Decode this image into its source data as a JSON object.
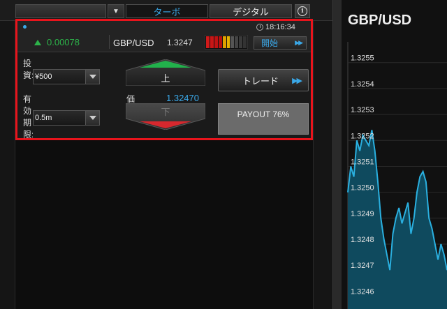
{
  "tabs": {
    "left_label": "",
    "turbo": "ターボ",
    "digital": "デジタル",
    "info_glyph": "i"
  },
  "panel": {
    "time": "18:16:34",
    "change": "0.00078",
    "pair": "GBP/USD",
    "rate": "1.3247",
    "meter_colors": [
      "#d11a1a",
      "#c91616",
      "#c01313",
      "#b81010",
      "#e0a000",
      "#e6b300",
      "#555555",
      "#444444",
      "#3a3a3a",
      "#333333"
    ],
    "start_label": "開始",
    "investment_label": "投資:",
    "investment_value": "¥500",
    "period_label": "有効期限:",
    "period_value": "0.5m",
    "up_label": "上",
    "down_label": "下",
    "price_label": "価",
    "price_value": "1.32470",
    "trade_label": "トレード",
    "payout_label": "PAYOUT 76%"
  },
  "chart_data": {
    "type": "area",
    "title": "GBP/USD",
    "y_ticks": [
      "1.3255",
      "1.3254",
      "1.3253",
      "1.3252",
      "1.3251",
      "1.3250",
      "1.3249",
      "1.3248",
      "1.3247",
      "1.3246"
    ],
    "ylim": [
      1.32455,
      1.32558
    ],
    "values": [
      1.325,
      1.3251,
      1.32506,
      1.3252,
      1.32516,
      1.32522,
      1.3252,
      1.32518,
      1.32524,
      1.32516,
      1.32504,
      1.3249,
      1.32482,
      1.32476,
      1.3247,
      1.32484,
      1.3249,
      1.32494,
      1.32488,
      1.32492,
      1.32496,
      1.32484,
      1.3249,
      1.325,
      1.32506,
      1.32508,
      1.32504,
      1.3249,
      1.32486,
      1.3248,
      1.32474,
      1.3248,
      1.32476,
      1.3247
    ],
    "line_color": "#2ab0e0",
    "fill_color": "#0f4a5e"
  }
}
